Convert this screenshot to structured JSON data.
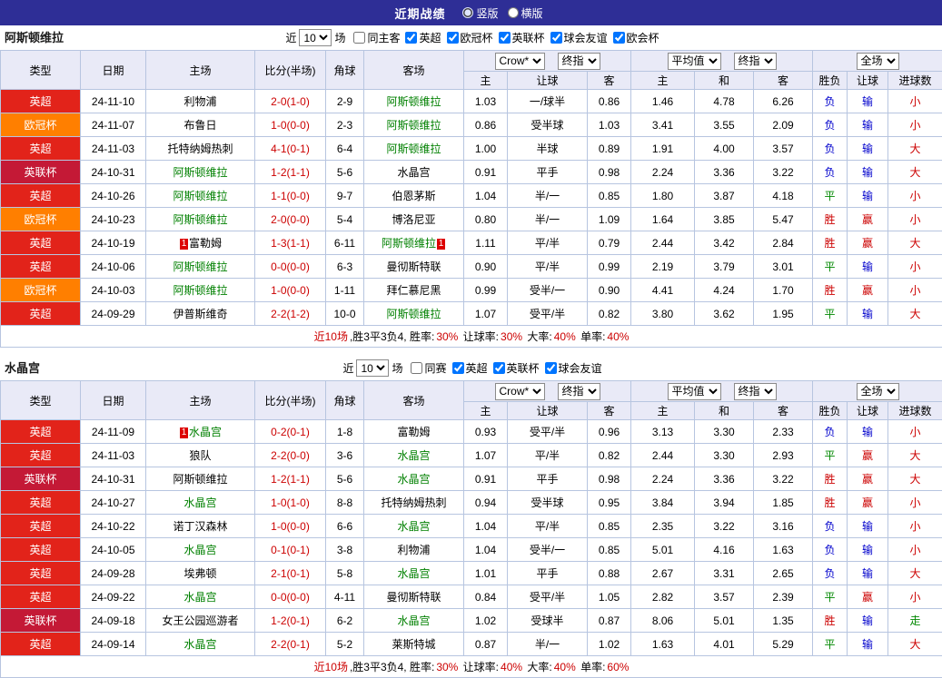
{
  "topbar": {
    "title": "近期战绩",
    "radios": [
      {
        "label": "竖版",
        "selected": true
      },
      {
        "label": "横版",
        "selected": false
      }
    ]
  },
  "league_colors": {
    "英超": "#e2231a",
    "欧冠杯": "#ff7f00",
    "英联杯": "#c41936"
  },
  "result_colors": {
    "r": "#cc0000",
    "g": "#008800",
    "b": "#0000cc",
    "k": "#000000"
  },
  "colors": {
    "topbar_bg": "#2e2e96",
    "header_bg": "#e9eaf7",
    "border": "#b7c5e0",
    "score": "#cc0000",
    "focus_team": "#008000",
    "badge": "#dd0000"
  },
  "columns": {
    "static": [
      "类型",
      "日期",
      "主场",
      "比分(半场)",
      "角球",
      "客场"
    ],
    "groups": [
      {
        "selects": [
          "Crow*",
          "终指"
        ],
        "cols": [
          "主",
          "让球",
          "客"
        ]
      },
      {
        "selects": [
          "平均值",
          "终指"
        ],
        "cols": [
          "主",
          "和",
          "客"
        ]
      },
      {
        "selects": [
          "全场"
        ],
        "cols": [
          "胜负",
          "让球",
          "进球数"
        ]
      }
    ]
  },
  "sections": [
    {
      "team": "阿斯顿维拉",
      "filter": {
        "near_label": "近",
        "count": "10",
        "games_label": "场",
        "checkboxes": [
          {
            "label": "同主客",
            "checked": false
          },
          {
            "label": "英超",
            "checked": true
          },
          {
            "label": "欧冠杯",
            "checked": true
          },
          {
            "label": "英联杯",
            "checked": true
          },
          {
            "label": "球会友谊",
            "checked": true
          },
          {
            "label": "欧会杯",
            "checked": true
          }
        ]
      },
      "rows": [
        {
          "league": "英超",
          "date": "24-11-10",
          "home": "利物浦",
          "home_focus": false,
          "home_badge": "",
          "score": "2-0(1-0)",
          "corner": "2-9",
          "away": "阿斯顿维拉",
          "away_focus": true,
          "away_badge": "",
          "odds": [
            "1.03",
            "一/球半",
            "0.86",
            "1.46",
            "4.78",
            "6.26"
          ],
          "results": [
            [
              "负",
              "b"
            ],
            [
              "输",
              "b"
            ],
            [
              "小",
              "r"
            ]
          ]
        },
        {
          "league": "欧冠杯",
          "date": "24-11-07",
          "home": "布鲁日",
          "home_focus": false,
          "home_badge": "",
          "score": "1-0(0-0)",
          "corner": "2-3",
          "away": "阿斯顿维拉",
          "away_focus": true,
          "away_badge": "",
          "odds": [
            "0.86",
            "受半球",
            "1.03",
            "3.41",
            "3.55",
            "2.09"
          ],
          "results": [
            [
              "负",
              "b"
            ],
            [
              "输",
              "b"
            ],
            [
              "小",
              "r"
            ]
          ]
        },
        {
          "league": "英超",
          "date": "24-11-03",
          "home": "托特纳姆热刺",
          "home_focus": false,
          "home_badge": "",
          "score": "4-1(0-1)",
          "corner": "6-4",
          "away": "阿斯顿维拉",
          "away_focus": true,
          "away_badge": "",
          "odds": [
            "1.00",
            "半球",
            "0.89",
            "1.91",
            "4.00",
            "3.57"
          ],
          "results": [
            [
              "负",
              "b"
            ],
            [
              "输",
              "b"
            ],
            [
              "大",
              "r"
            ]
          ]
        },
        {
          "league": "英联杯",
          "date": "24-10-31",
          "home": "阿斯顿维拉",
          "home_focus": true,
          "home_badge": "",
          "score": "1-2(1-1)",
          "corner": "5-6",
          "away": "水晶宫",
          "away_focus": false,
          "away_badge": "",
          "odds": [
            "0.91",
            "平手",
            "0.98",
            "2.24",
            "3.36",
            "3.22"
          ],
          "results": [
            [
              "负",
              "b"
            ],
            [
              "输",
              "b"
            ],
            [
              "大",
              "r"
            ]
          ]
        },
        {
          "league": "英超",
          "date": "24-10-26",
          "home": "阿斯顿维拉",
          "home_focus": true,
          "home_badge": "",
          "score": "1-1(0-0)",
          "corner": "9-7",
          "away": "伯恩茅斯",
          "away_focus": false,
          "away_badge": "",
          "odds": [
            "1.04",
            "半/一",
            "0.85",
            "1.80",
            "3.87",
            "4.18"
          ],
          "results": [
            [
              "平",
              "g"
            ],
            [
              "输",
              "b"
            ],
            [
              "小",
              "r"
            ]
          ]
        },
        {
          "league": "欧冠杯",
          "date": "24-10-23",
          "home": "阿斯顿维拉",
          "home_focus": true,
          "home_badge": "",
          "score": "2-0(0-0)",
          "corner": "5-4",
          "away": "博洛尼亚",
          "away_focus": false,
          "away_badge": "",
          "odds": [
            "0.80",
            "半/一",
            "1.09",
            "1.64",
            "3.85",
            "5.47"
          ],
          "results": [
            [
              "胜",
              "r"
            ],
            [
              "赢",
              "r"
            ],
            [
              "小",
              "r"
            ]
          ]
        },
        {
          "league": "英超",
          "date": "24-10-19",
          "home": "富勒姆",
          "home_focus": false,
          "home_badge": "1",
          "score": "1-3(1-1)",
          "corner": "6-11",
          "away": "阿斯顿维拉",
          "away_focus": true,
          "away_badge": "1",
          "odds": [
            "1.11",
            "平/半",
            "0.79",
            "2.44",
            "3.42",
            "2.84"
          ],
          "results": [
            [
              "胜",
              "r"
            ],
            [
              "赢",
              "r"
            ],
            [
              "大",
              "r"
            ]
          ]
        },
        {
          "league": "英超",
          "date": "24-10-06",
          "home": "阿斯顿维拉",
          "home_focus": true,
          "home_badge": "",
          "score": "0-0(0-0)",
          "corner": "6-3",
          "away": "曼彻斯特联",
          "away_focus": false,
          "away_badge": "",
          "odds": [
            "0.90",
            "平/半",
            "0.99",
            "2.19",
            "3.79",
            "3.01"
          ],
          "results": [
            [
              "平",
              "g"
            ],
            [
              "输",
              "b"
            ],
            [
              "小",
              "r"
            ]
          ]
        },
        {
          "league": "欧冠杯",
          "date": "24-10-03",
          "home": "阿斯顿维拉",
          "home_focus": true,
          "home_badge": "",
          "score": "1-0(0-0)",
          "corner": "1-11",
          "away": "拜仁慕尼黑",
          "away_focus": false,
          "away_badge": "",
          "odds": [
            "0.99",
            "受半/一",
            "0.90",
            "4.41",
            "4.24",
            "1.70"
          ],
          "results": [
            [
              "胜",
              "r"
            ],
            [
              "赢",
              "r"
            ],
            [
              "小",
              "r"
            ]
          ]
        },
        {
          "league": "英超",
          "date": "24-09-29",
          "home": "伊普斯维奇",
          "home_focus": false,
          "home_badge": "",
          "score": "2-2(1-2)",
          "corner": "10-0",
          "away": "阿斯顿维拉",
          "away_focus": true,
          "away_badge": "",
          "odds": [
            "1.07",
            "受平/半",
            "0.82",
            "3.80",
            "3.62",
            "1.95"
          ],
          "results": [
            [
              "平",
              "g"
            ],
            [
              "输",
              "b"
            ],
            [
              "大",
              "r"
            ]
          ]
        }
      ],
      "summary": [
        [
          "近10场",
          "r"
        ],
        [
          ",胜3平3负4, 胜率:",
          "k"
        ],
        [
          "30%",
          "r"
        ],
        [
          " 让球率:",
          "k"
        ],
        [
          "30%",
          "r"
        ],
        [
          " 大率:",
          "k"
        ],
        [
          "40%",
          "r"
        ],
        [
          " 单率:",
          "k"
        ],
        [
          "40%",
          "r"
        ]
      ]
    },
    {
      "team": "水晶宫",
      "filter": {
        "near_label": "近",
        "count": "10",
        "games_label": "场",
        "checkboxes": [
          {
            "label": "同赛",
            "checked": false
          },
          {
            "label": "英超",
            "checked": true
          },
          {
            "label": "英联杯",
            "checked": true
          },
          {
            "label": "球会友谊",
            "checked": true
          }
        ]
      },
      "rows": [
        {
          "league": "英超",
          "date": "24-11-09",
          "home": "水晶宫",
          "home_focus": true,
          "home_badge": "1",
          "score": "0-2(0-1)",
          "corner": "1-8",
          "away": "富勒姆",
          "away_focus": false,
          "away_badge": "",
          "odds": [
            "0.93",
            "受平/半",
            "0.96",
            "3.13",
            "3.30",
            "2.33"
          ],
          "results": [
            [
              "负",
              "b"
            ],
            [
              "输",
              "b"
            ],
            [
              "小",
              "r"
            ]
          ]
        },
        {
          "league": "英超",
          "date": "24-11-03",
          "home": "狼队",
          "home_focus": false,
          "home_badge": "",
          "score": "2-2(0-0)",
          "corner": "3-6",
          "away": "水晶宫",
          "away_focus": true,
          "away_badge": "",
          "odds": [
            "1.07",
            "平/半",
            "0.82",
            "2.44",
            "3.30",
            "2.93"
          ],
          "results": [
            [
              "平",
              "g"
            ],
            [
              "赢",
              "r"
            ],
            [
              "大",
              "r"
            ]
          ]
        },
        {
          "league": "英联杯",
          "date": "24-10-31",
          "home": "阿斯顿维拉",
          "home_focus": false,
          "home_badge": "",
          "score": "1-2(1-1)",
          "corner": "5-6",
          "away": "水晶宫",
          "away_focus": true,
          "away_badge": "",
          "odds": [
            "0.91",
            "平手",
            "0.98",
            "2.24",
            "3.36",
            "3.22"
          ],
          "results": [
            [
              "胜",
              "r"
            ],
            [
              "赢",
              "r"
            ],
            [
              "大",
              "r"
            ]
          ]
        },
        {
          "league": "英超",
          "date": "24-10-27",
          "home": "水晶宫",
          "home_focus": true,
          "home_badge": "",
          "score": "1-0(1-0)",
          "corner": "8-8",
          "away": "托特纳姆热刺",
          "away_focus": false,
          "away_badge": "",
          "odds": [
            "0.94",
            "受半球",
            "0.95",
            "3.84",
            "3.94",
            "1.85"
          ],
          "results": [
            [
              "胜",
              "r"
            ],
            [
              "赢",
              "r"
            ],
            [
              "小",
              "r"
            ]
          ]
        },
        {
          "league": "英超",
          "date": "24-10-22",
          "home": "诺丁汉森林",
          "home_focus": false,
          "home_badge": "",
          "score": "1-0(0-0)",
          "corner": "6-6",
          "away": "水晶宫",
          "away_focus": true,
          "away_badge": "",
          "odds": [
            "1.04",
            "平/半",
            "0.85",
            "2.35",
            "3.22",
            "3.16"
          ],
          "results": [
            [
              "负",
              "b"
            ],
            [
              "输",
              "b"
            ],
            [
              "小",
              "r"
            ]
          ]
        },
        {
          "league": "英超",
          "date": "24-10-05",
          "home": "水晶宫",
          "home_focus": true,
          "home_badge": "",
          "score": "0-1(0-1)",
          "corner": "3-8",
          "away": "利物浦",
          "away_focus": false,
          "away_badge": "",
          "odds": [
            "1.04",
            "受半/一",
            "0.85",
            "5.01",
            "4.16",
            "1.63"
          ],
          "results": [
            [
              "负",
              "b"
            ],
            [
              "输",
              "b"
            ],
            [
              "小",
              "r"
            ]
          ]
        },
        {
          "league": "英超",
          "date": "24-09-28",
          "home": "埃弗顿",
          "home_focus": false,
          "home_badge": "",
          "score": "2-1(0-1)",
          "corner": "5-8",
          "away": "水晶宫",
          "away_focus": true,
          "away_badge": "",
          "odds": [
            "1.01",
            "平手",
            "0.88",
            "2.67",
            "3.31",
            "2.65"
          ],
          "results": [
            [
              "负",
              "b"
            ],
            [
              "输",
              "b"
            ],
            [
              "大",
              "r"
            ]
          ]
        },
        {
          "league": "英超",
          "date": "24-09-22",
          "home": "水晶宫",
          "home_focus": true,
          "home_badge": "",
          "score": "0-0(0-0)",
          "corner": "4-11",
          "away": "曼彻斯特联",
          "away_focus": false,
          "away_badge": "",
          "odds": [
            "0.84",
            "受平/半",
            "1.05",
            "2.82",
            "3.57",
            "2.39"
          ],
          "results": [
            [
              "平",
              "g"
            ],
            [
              "赢",
              "r"
            ],
            [
              "小",
              "r"
            ]
          ]
        },
        {
          "league": "英联杯",
          "date": "24-09-18",
          "home": "女王公园巡游者",
          "home_focus": false,
          "home_badge": "",
          "score": "1-2(0-1)",
          "corner": "6-2",
          "away": "水晶宫",
          "away_focus": true,
          "away_badge": "",
          "odds": [
            "1.02",
            "受球半",
            "0.87",
            "8.06",
            "5.01",
            "1.35"
          ],
          "results": [
            [
              "胜",
              "r"
            ],
            [
              "输",
              "b"
            ],
            [
              "走",
              "g"
            ]
          ]
        },
        {
          "league": "英超",
          "date": "24-09-14",
          "home": "水晶宫",
          "home_focus": true,
          "home_badge": "",
          "score": "2-2(0-1)",
          "corner": "5-2",
          "away": "莱斯特城",
          "away_focus": false,
          "away_badge": "",
          "odds": [
            "0.87",
            "半/一",
            "1.02",
            "1.63",
            "4.01",
            "5.29"
          ],
          "results": [
            [
              "平",
              "g"
            ],
            [
              "输",
              "b"
            ],
            [
              "大",
              "r"
            ]
          ]
        }
      ],
      "summary": [
        [
          "近10场",
          "r"
        ],
        [
          ",胜3平3负4, 胜率:",
          "k"
        ],
        [
          "30%",
          "r"
        ],
        [
          " 让球率:",
          "k"
        ],
        [
          "40%",
          "r"
        ],
        [
          " 大率:",
          "k"
        ],
        [
          "40%",
          "r"
        ],
        [
          " 单率:",
          "k"
        ],
        [
          "60%",
          "r"
        ]
      ]
    }
  ]
}
